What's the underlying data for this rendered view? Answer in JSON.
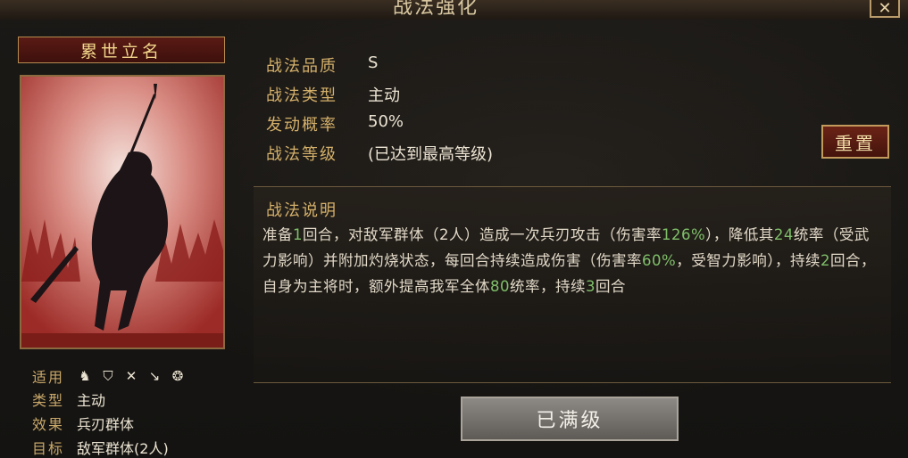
{
  "window": {
    "title": "战法强化",
    "close_label": "✕"
  },
  "skill": {
    "name": "累世立名",
    "info": {
      "applicable_label": "适用",
      "applicable_icons": [
        "cavalry-icon",
        "shield-icon",
        "bow-icon",
        "spear-icon",
        "chariot-wheel-icon"
      ],
      "type_label": "类型",
      "type_value": "主动",
      "effect_label": "效果",
      "effect_value": "兵刃群体",
      "target_label": "目标",
      "target_value": "敌军群体(2人)"
    }
  },
  "fields": {
    "quality_label": "战法品质",
    "quality_value": "S",
    "type_label": "战法类型",
    "type_value": "主动",
    "chance_label": "发动概率",
    "chance_value": "50%",
    "level_label": "战法等级",
    "level_value": "(已达到最高等级)"
  },
  "reset_label": "重置",
  "description": {
    "title": "战法说明",
    "parts": [
      "准备",
      "1",
      "回合，对敌军群体（2人）造成一次兵刃攻击（伤害率",
      "126%",
      "），降低其",
      "24",
      "统率（受武力影响）并附加灼烧状态，每回合持续造成伤害（伤害率",
      "60%",
      "，受智力影响），持续",
      "2",
      "回合，自身为主将时，额外提高我军全体",
      "80",
      "统率，持续",
      "3",
      "回合"
    ]
  },
  "maxed_label": "已满级",
  "colors": {
    "accent_gold": "#d4b06a",
    "number_green": "#7fbf6a",
    "reset_red": "#6b2316"
  }
}
